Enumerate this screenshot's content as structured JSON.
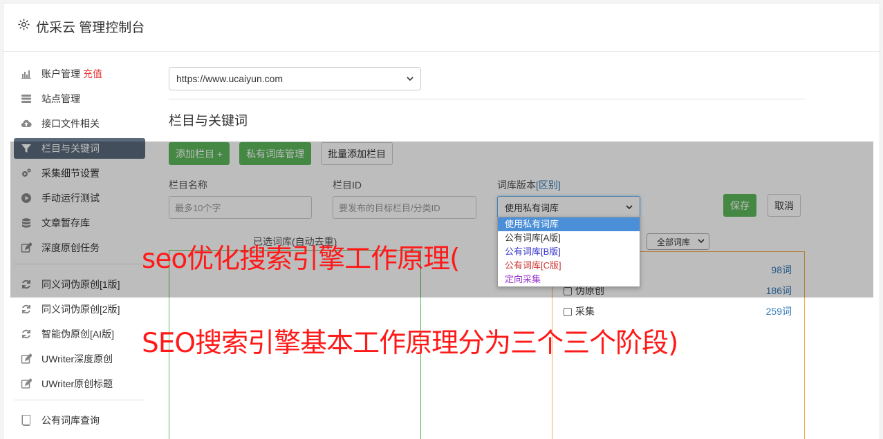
{
  "brand": {
    "title": "优采云 管理控制台",
    "icon": "gear-icon"
  },
  "sidebar": {
    "items": [
      {
        "label": "账户管理",
        "icon": "bar-chart-icon",
        "badge": "充值"
      },
      {
        "label": "站点管理",
        "icon": "server-icon"
      },
      {
        "label": "接口文件相关",
        "icon": "cloud-upload-icon"
      },
      {
        "label": "栏目与关键词",
        "icon": "filter-icon",
        "active": true
      },
      {
        "label": "采集细节设置",
        "icon": "gears-icon"
      },
      {
        "label": "手动运行测试",
        "icon": "play-circle-icon"
      },
      {
        "label": "文章暂存库",
        "icon": "database-icon"
      },
      {
        "label": "深度原创任务",
        "icon": "edit-icon"
      }
    ],
    "items2": [
      {
        "label": "同义词伪原创[1版]",
        "icon": "refresh-icon"
      },
      {
        "label": "同义词伪原创[2版]",
        "icon": "refresh-icon"
      },
      {
        "label": "智能伪原创[AI版]",
        "icon": "refresh-icon"
      },
      {
        "label": "UWriter深度原创",
        "icon": "edit-icon"
      },
      {
        "label": "UWriter原创标题",
        "icon": "edit-icon"
      }
    ],
    "items3": [
      {
        "label": "公有词库查询",
        "icon": "book-icon"
      }
    ]
  },
  "main": {
    "site_select": "https://www.ucaiyun.com",
    "section_title": "栏目与关键词",
    "buttons": {
      "add_column": "添加栏目 +",
      "private_lib": "私有词库管理",
      "batch_add": "批量添加栏目"
    },
    "form": {
      "name_label": "栏目名称",
      "name_placeholder": "最多10个字",
      "id_label": "栏目ID",
      "id_placeholder": "要发布的目标栏目/分类ID",
      "version_label": "词库版本",
      "version_link": "[区别]",
      "version_value": "使用私有词库",
      "save": "保存",
      "cancel": "取消"
    },
    "dropdown_options": [
      {
        "label": "使用私有词库",
        "color": "#ffffff",
        "selected": true
      },
      {
        "label": "公有词库[A版]",
        "color": "#333333"
      },
      {
        "label": "公有词库[B版]",
        "color": "#3333cc"
      },
      {
        "label": "公有词库[C版]",
        "color": "#cc3333"
      },
      {
        "label": "定向采集",
        "color": "#9933cc"
      }
    ],
    "lib_label": "已选词库(自动去重)",
    "lib_filter": "全部词库",
    "libs": [
      {
        "label": "",
        "count": "98词"
      },
      {
        "label": "伪原创",
        "count": "186词"
      },
      {
        "label": "采集",
        "count": "259词"
      }
    ]
  },
  "overlay_text": {
    "line1": "seo优化搜索引擎工作原理(",
    "line2": "SEO搜索引擎基本工作原理分为三个三个阶段)"
  }
}
